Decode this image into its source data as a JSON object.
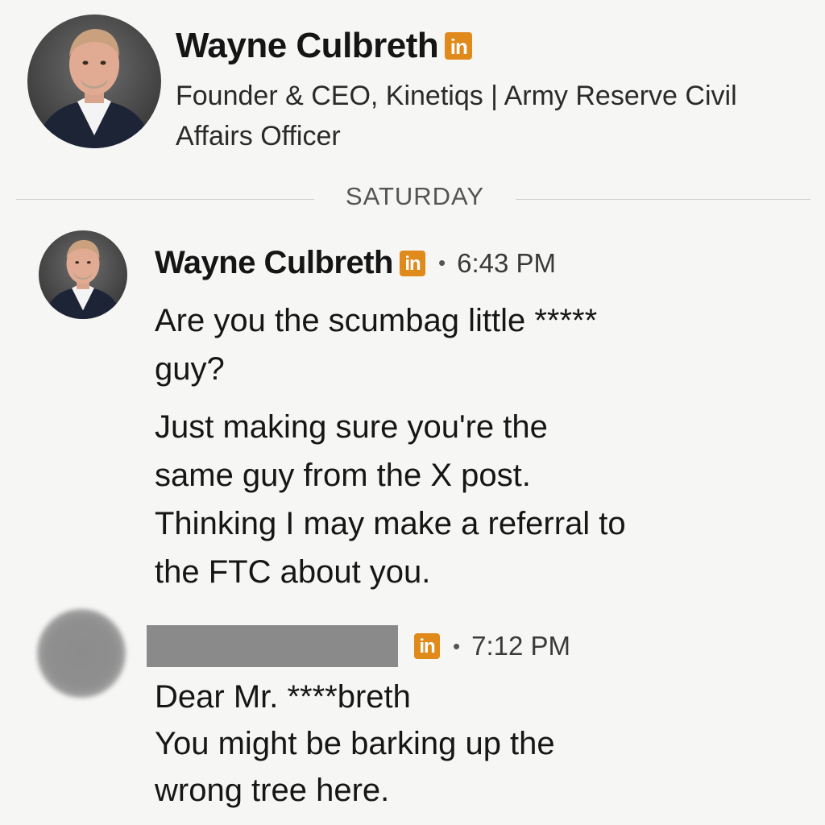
{
  "profile": {
    "name": "Wayne Culbreth",
    "badge": "in",
    "headline": "Founder & CEO, Kinetiqs | Army Reserve Civil Affairs Officer"
  },
  "divider": {
    "label": "SATURDAY"
  },
  "messages": [
    {
      "sender": "Wayne Culbreth",
      "badge": "in",
      "separator": "•",
      "time": "6:43 PM",
      "paragraphs": [
        [
          "Are you the scumbag little *****",
          "guy?"
        ],
        [
          "Just making sure you're the",
          "same guy from the X post.",
          "Thinking I may make a referral to",
          "the FTC about you."
        ]
      ]
    },
    {
      "sender": "",
      "badge": "in",
      "separator": "•",
      "time": "7:12 PM",
      "paragraphs": [
        [
          "Dear Mr.  ****breth",
          "You might be barking up the",
          "wrong tree here."
        ]
      ]
    }
  ],
  "colors": {
    "background": "#f6f6f4",
    "badge": "#e08a1c",
    "redaction": "#8a8a8a"
  }
}
